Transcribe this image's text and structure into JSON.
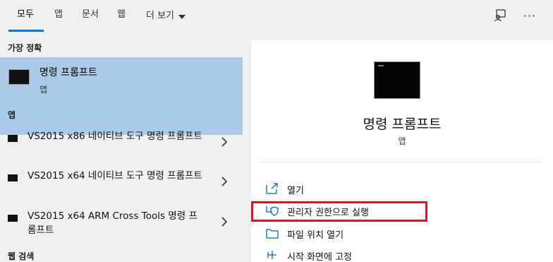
{
  "tabs": [
    {
      "label": "모두",
      "active": true
    },
    {
      "label": "앱",
      "active": false
    },
    {
      "label": "문서",
      "active": false
    },
    {
      "label": "웹",
      "active": false
    },
    {
      "label": "더 보기",
      "active": false
    }
  ],
  "top_icons": [
    "feedback-icon",
    "more-options-icon"
  ],
  "more_icon_text": "···",
  "left": {
    "best_match_header": "가장 정확",
    "best_match": {
      "name": "명령 프롬프트",
      "type": "앱"
    },
    "apps_header": "앱",
    "apps": [
      {
        "label": "VS2015 x86 네이티브 도구 명령 프롬프트"
      },
      {
        "label": "VS2015 x64 네이티브 도구 명령 프롬프트"
      },
      {
        "label": "VS2015 x64 ARM Cross Tools 명령 프롬프트"
      }
    ],
    "web_header": "웹 검색"
  },
  "right": {
    "title": "명령 프롬프트",
    "subtitle": "앱",
    "actions": [
      {
        "label": "열기",
        "icon": "open-icon"
      },
      {
        "label": "관리자 권한으로 실행",
        "icon": "shield-icon",
        "highlighted": true
      },
      {
        "label": "파일 위치 열기",
        "icon": "folder-icon"
      },
      {
        "label": "시작 화면에 고정",
        "icon": "pin-icon"
      }
    ]
  },
  "colors": {
    "accent": "#0078d7",
    "selection": "#a9cbe8",
    "highlight_border": "#e81123"
  }
}
